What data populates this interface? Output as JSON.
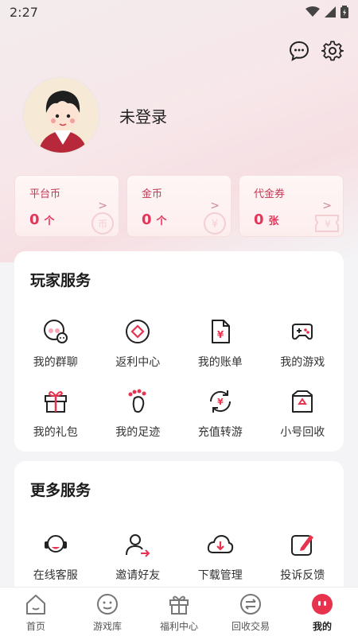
{
  "status": {
    "time": "2:27"
  },
  "colors": {
    "accent": "#e8334f",
    "card_text": "#c13a54"
  },
  "header": {
    "icons": [
      "message-icon",
      "gear-icon"
    ]
  },
  "profile": {
    "login_text": "未登录"
  },
  "wallet": [
    {
      "title": "平台币",
      "value": "0",
      "unit": "个"
    },
    {
      "title": "金币",
      "value": "0",
      "unit": "个"
    },
    {
      "title": "代金券",
      "value": "0",
      "unit": "张"
    }
  ],
  "player_services": {
    "title": "玩家服务",
    "items": [
      {
        "label": "我的群聊",
        "icon": "group-chat-icon"
      },
      {
        "label": "返利中心",
        "icon": "rebate-icon"
      },
      {
        "label": "我的账单",
        "icon": "bill-icon"
      },
      {
        "label": "我的游戏",
        "icon": "gamepad-icon"
      },
      {
        "label": "我的礼包",
        "icon": "gift-icon"
      },
      {
        "label": "我的足迹",
        "icon": "footprint-icon"
      },
      {
        "label": "充值转游",
        "icon": "recharge-transfer-icon"
      },
      {
        "label": "小号回收",
        "icon": "recycle-icon"
      }
    ]
  },
  "more_services": {
    "title": "更多服务",
    "items": [
      {
        "label": "在线客服",
        "icon": "customer-service-icon"
      },
      {
        "label": "邀请好友",
        "icon": "invite-friend-icon"
      },
      {
        "label": "下载管理",
        "icon": "download-icon"
      },
      {
        "label": "投诉反馈",
        "icon": "feedback-icon"
      }
    ]
  },
  "tabbar": {
    "items": [
      {
        "label": "首页",
        "icon": "home-icon",
        "active": false
      },
      {
        "label": "游戏库",
        "icon": "game-library-icon",
        "active": false
      },
      {
        "label": "福利中心",
        "icon": "gift-box-icon",
        "active": false
      },
      {
        "label": "回收交易",
        "icon": "trade-icon",
        "active": false
      },
      {
        "label": "我的",
        "icon": "profile-icon",
        "active": true
      }
    ]
  }
}
